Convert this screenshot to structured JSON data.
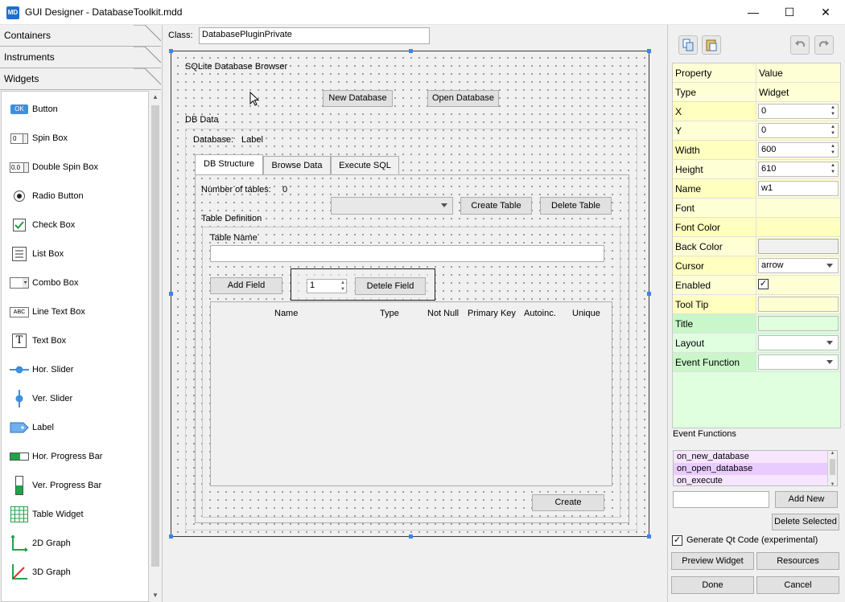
{
  "window": {
    "app_icon": "MD",
    "title": "GUI Designer - DatabaseToolkit.mdd",
    "minimize": "—",
    "maximize": "☐",
    "close": "✕"
  },
  "palette": {
    "categories": [
      "Containers",
      "Instruments",
      "Widgets"
    ],
    "items": [
      {
        "label": "Button",
        "icon": "button-icon"
      },
      {
        "label": "Spin Box",
        "icon": "spin-box-icon"
      },
      {
        "label": "Double Spin Box",
        "icon": "double-spin-box-icon"
      },
      {
        "label": "Radio Button",
        "icon": "radio-button-icon"
      },
      {
        "label": "Check Box",
        "icon": "check-box-icon"
      },
      {
        "label": "List Box",
        "icon": "list-box-icon"
      },
      {
        "label": "Combo Box",
        "icon": "combo-box-icon"
      },
      {
        "label": "Line Text Box",
        "icon": "line-text-box-icon"
      },
      {
        "label": "Text Box",
        "icon": "text-box-icon"
      },
      {
        "label": "Hor. Slider",
        "icon": "hor-slider-icon"
      },
      {
        "label": "Ver. Slider",
        "icon": "ver-slider-icon"
      },
      {
        "label": "Label",
        "icon": "label-icon"
      },
      {
        "label": "Hor. Progress Bar",
        "icon": "hor-progress-bar-icon"
      },
      {
        "label": "Ver. Progress Bar",
        "icon": "ver-progress-bar-icon"
      },
      {
        "label": "Table Widget",
        "icon": "table-widget-icon"
      },
      {
        "label": "2D Graph",
        "icon": "graph-2d-icon"
      },
      {
        "label": "3D Graph",
        "icon": "graph-3d-icon"
      }
    ],
    "icon_text": {
      "button": "OK",
      "spin": "0",
      "double_spin": "0.0",
      "line_text": "ABC",
      "text_box": "T"
    }
  },
  "designer": {
    "class_label": "Class:",
    "class_value": "DatabasePluginPrivate",
    "title_label": "SQLite Database Browser",
    "new_db_button": "New Database",
    "open_db_button": "Open Database",
    "db_data_label": "DB Data",
    "database_label": "Database:",
    "database_value": "Label",
    "tabs": [
      "DB Structure",
      "Browse Data",
      "Execute SQL"
    ],
    "num_tables_label": "Number of tables:",
    "num_tables_value": "0",
    "create_table_button": "Create Table",
    "delete_table_button": "Delete Table",
    "table_def_label": "Table Definition",
    "table_name_label": "Table Name",
    "add_field_button": "Add Field",
    "field_spin_value": "1",
    "delete_field_button": "Detele Field",
    "columns": [
      "Name",
      "Type",
      "Not Null",
      "Primary Key",
      "Autoinc.",
      "Unique"
    ],
    "create_button": "Create"
  },
  "properties": {
    "header": [
      "Property",
      "Value"
    ],
    "rows": [
      {
        "name": "Type",
        "value": "Widget"
      },
      {
        "name": "X",
        "value": "0"
      },
      {
        "name": "Y",
        "value": "0"
      },
      {
        "name": "Width",
        "value": "600"
      },
      {
        "name": "Height",
        "value": "610"
      },
      {
        "name": "Name",
        "value": "w1"
      },
      {
        "name": "Font",
        "value": ""
      },
      {
        "name": "Font Color",
        "value": ""
      },
      {
        "name": "Back Color",
        "value": ""
      },
      {
        "name": "Cursor",
        "value": "arrow"
      },
      {
        "name": "Enabled",
        "value": "✓"
      },
      {
        "name": "Tool Tip",
        "value": ""
      },
      {
        "name": "Title",
        "value": ""
      },
      {
        "name": "Layout",
        "value": ""
      },
      {
        "name": "Event Function",
        "value": ""
      }
    ],
    "colors": {
      "yellow": "#ffffd6",
      "yellow_strong": "#ffffbf",
      "green": "#dfffdf",
      "green_strong": "#c9f7c9"
    }
  },
  "events": {
    "label": "Event Functions",
    "items": [
      "on_new_database",
      "on_open_database",
      "on_execute"
    ],
    "add_new_button": "Add New",
    "delete_selected_button": "Delete Selected",
    "generate_qt_label": "Generate Qt Code (experimental)",
    "generate_qt_checked": "✓",
    "preview_button": "Preview Widget",
    "resources_button": "Resources",
    "done_button": "Done",
    "cancel_button": "Cancel"
  }
}
